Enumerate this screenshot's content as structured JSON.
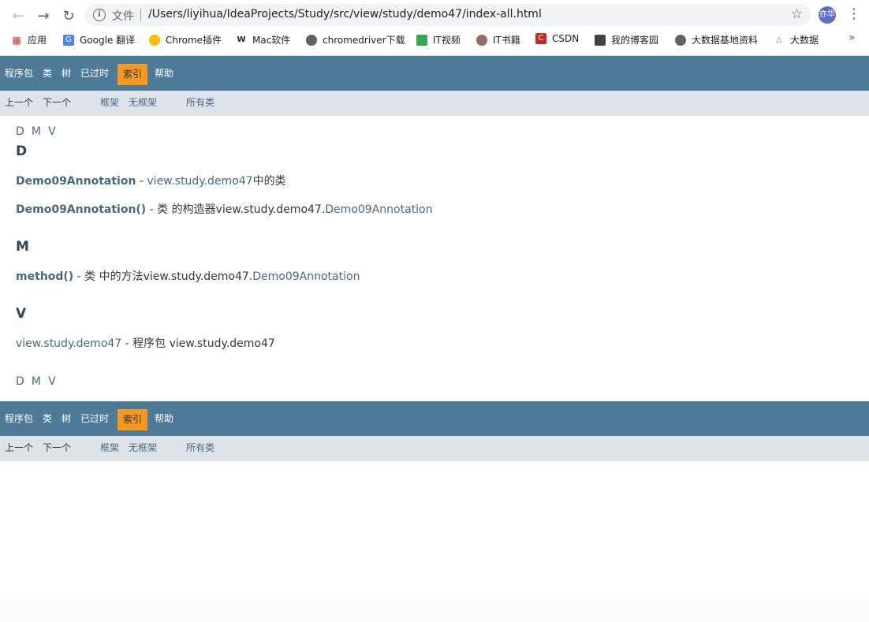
{
  "browser": {
    "scheme_label": "文件",
    "url": "/Users/liyihua/IdeaProjects/Study/src/view/study/demo47/index-all.html",
    "profile_label": "亦华",
    "bookmarks": [
      "应用",
      "Google 翻译",
      "Chrome插件",
      "Mac软件",
      "chromedriver下载",
      "IT视频",
      "IT书籍",
      "CSDN",
      "我的博客园",
      "大数据基地资料",
      "大数据"
    ],
    "more_label": "»"
  },
  "topnav": {
    "items": [
      "程序包",
      "类",
      "树",
      "已过时",
      "索引",
      "帮助"
    ],
    "active": "索引"
  },
  "subnav": {
    "prev": "上一个",
    "next": "下一个",
    "frames": "框架",
    "noframes": "无框架",
    "allclasses": "所有类"
  },
  "index": {
    "letters": [
      "D",
      "M",
      "V"
    ],
    "sections": [
      {
        "letter": "D",
        "entries": [
          {
            "name": "Demo09Annotation",
            "desc_prefix": " - ",
            "link": "view.study.demo47",
            "desc_suffix": "中的类"
          },
          {
            "name": "Demo09Annotation()",
            "desc_prefix": " - 类 的构造器view.study.demo47.",
            "link": "Demo09Annotation",
            "desc_suffix": ""
          }
        ]
      },
      {
        "letter": "M",
        "entries": [
          {
            "name": "method()",
            "desc_prefix": " - 类 中的方法view.study.demo47.",
            "link": "Demo09Annotation",
            "desc_suffix": ""
          }
        ]
      },
      {
        "letter": "V",
        "entries": [
          {
            "link": "view.study.demo47",
            "desc_suffix": " - 程序包 view.study.demo47"
          }
        ]
      }
    ]
  },
  "colors": {
    "nav_bg": "#4d7a97",
    "active_bg": "#f8981d",
    "subnav_bg": "#dee3e9",
    "link": "#4a6782"
  }
}
